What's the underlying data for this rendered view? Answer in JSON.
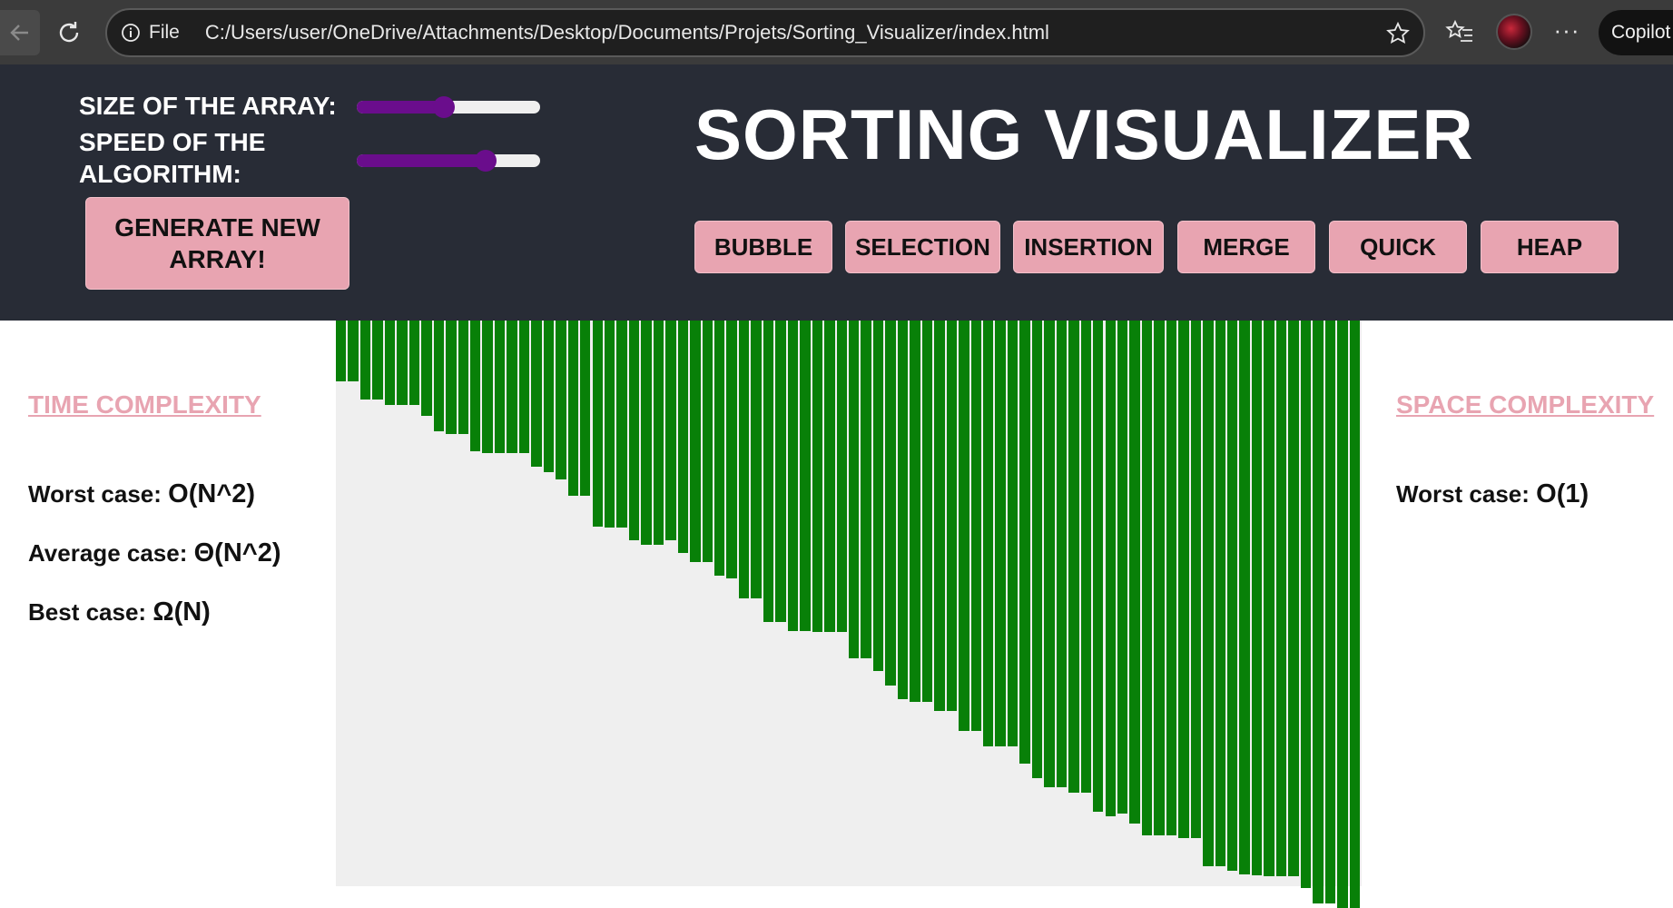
{
  "browser": {
    "file_label": "File",
    "url": "C:/Users/user/OneDrive/Attachments/Desktop/Documents/Projets/Sorting_Visualizer/index.html",
    "copilot_label": "Copilot"
  },
  "controls": {
    "size_label": "SIZE OF THE ARRAY:",
    "speed_label_line1": "SPEED OF THE",
    "speed_label_line2": "ALGORITHM:",
    "size_value": 0.47,
    "speed_value": 0.73,
    "generate_line1": "GENERATE NEW",
    "generate_line2": "ARRAY!"
  },
  "title": "SORTING VISUALIZER",
  "algorithms": [
    "BUBBLE",
    "SELECTION",
    "INSERTION",
    "MERGE",
    "QUICK",
    "HEAP"
  ],
  "time_complexity": {
    "heading": "TIME COMPLEXITY",
    "worst_label": "Worst case:",
    "worst_value": "O(N^2)",
    "average_label": "Average case:",
    "average_value": "Θ(N^2)",
    "best_label": "Best case:",
    "best_value": "Ω(N)"
  },
  "space_complexity": {
    "heading": "SPACE COMPLEXITY",
    "worst_label": "Worst case:",
    "worst_value": "O(1)"
  },
  "colors": {
    "header_bg": "#282c36",
    "button_bg": "#e8a4b1",
    "slider_fill": "#6a0d8c",
    "bar": "#088008",
    "bars_bg": "#efefef"
  },
  "chart_data": {
    "type": "bar",
    "values": [
      67,
      67,
      87,
      87,
      93,
      93,
      93,
      105,
      122,
      125,
      125,
      144,
      146,
      146,
      146,
      146,
      161,
      167,
      175,
      193,
      193,
      227,
      228,
      228,
      242,
      247,
      247,
      242,
      256,
      266,
      266,
      281,
      284,
      306,
      306,
      332,
      332,
      342,
      342,
      343,
      343,
      343,
      372,
      372,
      386,
      402,
      417,
      420,
      420,
      430,
      430,
      452,
      452,
      469,
      469,
      469,
      488,
      504,
      514,
      514,
      520,
      520,
      541,
      546,
      543,
      554,
      567,
      567,
      567,
      570,
      570,
      601,
      601,
      606,
      610,
      611,
      612,
      612,
      612,
      625,
      642,
      642,
      647,
      647
    ],
    "title": "",
    "xlabel": "",
    "ylabel": ""
  }
}
